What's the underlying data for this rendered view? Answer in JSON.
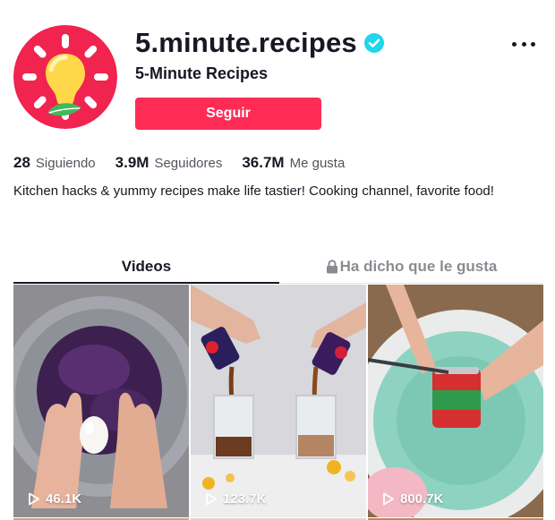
{
  "profile": {
    "username": "5.minute.recipes",
    "nickname": "5-Minute Recipes",
    "follow_label": "Seguir",
    "bio": "Kitchen hacks & yummy recipes make life tastier! Cooking channel, favorite food!",
    "verified": true
  },
  "stats": [
    {
      "value": "28",
      "label": "Siguiendo"
    },
    {
      "value": "3.9M",
      "label": "Seguidores"
    },
    {
      "value": "36.7M",
      "label": "Me gusta"
    }
  ],
  "tabs": [
    {
      "label": "Videos",
      "active": true
    },
    {
      "label": "Ha dicho que le gusta",
      "active": false,
      "icon": "lock-icon"
    }
  ],
  "videos": [
    {
      "views": "46.1K"
    },
    {
      "views": "123.7K"
    },
    {
      "views": "800.7K"
    }
  ],
  "colors": {
    "accent": "#fe2c55",
    "verified": "#20d5ec",
    "text": "#161823",
    "avatar_bg": "#f1234f"
  }
}
